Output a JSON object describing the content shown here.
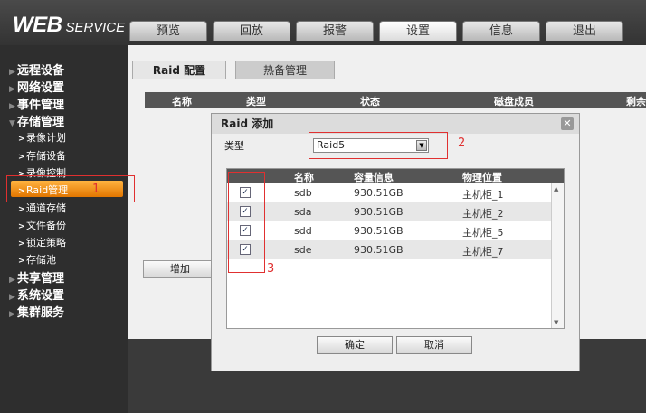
{
  "logo": {
    "main": "WEB",
    "sub": "SERVICE"
  },
  "nav": {
    "tabs": [
      "预览",
      "回放",
      "报警",
      "设置",
      "信息",
      "退出"
    ],
    "active_index": 3
  },
  "sidebar": {
    "items": [
      {
        "label": "远程设备",
        "level": 1
      },
      {
        "label": "网络设置",
        "level": 1
      },
      {
        "label": "事件管理",
        "level": 1
      },
      {
        "label": "存储管理",
        "level": 1
      },
      {
        "label": "录像计划",
        "level": 2
      },
      {
        "label": "存储设备",
        "level": 2
      },
      {
        "label": "录像控制",
        "level": 2
      },
      {
        "label": "Raid管理",
        "level": 2,
        "selected": true
      },
      {
        "label": "通道存储",
        "level": 2
      },
      {
        "label": "文件备份",
        "level": 2
      },
      {
        "label": "锁定策略",
        "level": 2
      },
      {
        "label": "存储池",
        "level": 2
      },
      {
        "label": "共享管理",
        "level": 1
      },
      {
        "label": "系统设置",
        "level": 1
      },
      {
        "label": "集群服务",
        "level": 1
      }
    ]
  },
  "main": {
    "tabs": [
      "Raid 配置",
      "热备管理"
    ],
    "table_headers": [
      "名称",
      "类型",
      "状态",
      "磁盘成员",
      "剩余"
    ],
    "add_button": "增加"
  },
  "dialog": {
    "title": "Raid 添加",
    "close": "✕",
    "type_label": "类型",
    "type_value": "Raid5",
    "columns": [
      "名称",
      "容量信息",
      "物理位置"
    ],
    "rows": [
      {
        "checked": true,
        "name": "sdb",
        "capacity": "930.51GB",
        "location": "主机柜_1"
      },
      {
        "checked": true,
        "name": "sda",
        "capacity": "930.51GB",
        "location": "主机柜_2"
      },
      {
        "checked": true,
        "name": "sdd",
        "capacity": "930.51GB",
        "location": "主机柜_5"
      },
      {
        "checked": true,
        "name": "sde",
        "capacity": "930.51GB",
        "location": "主机柜_7"
      }
    ],
    "ok_button": "确定",
    "cancel_button": "取消"
  },
  "annotations": [
    "1",
    "2",
    "3"
  ],
  "colors": {
    "accent": "#e27600",
    "annotation": "#e03030"
  }
}
